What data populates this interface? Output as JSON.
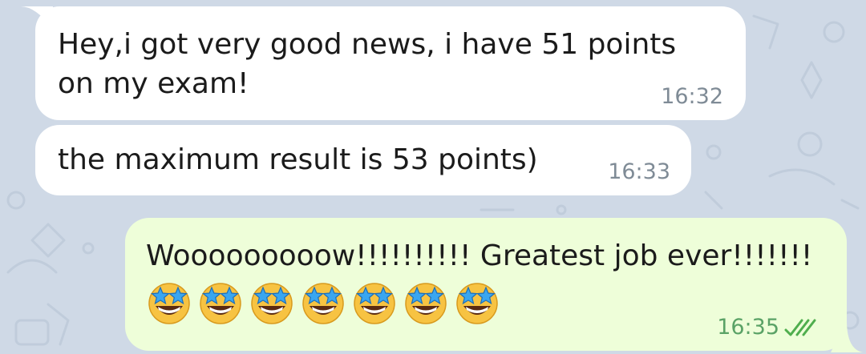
{
  "messages": [
    {
      "direction": "incoming",
      "lines": [
        "Hey,i got very good news, i have 51 points",
        "on my exam!"
      ],
      "time": "16:32"
    },
    {
      "direction": "incoming",
      "lines": [
        "the maximum result is 53 points)"
      ],
      "time": "16:33"
    },
    {
      "direction": "outgoing",
      "lines": [
        "Wooooooooow!!!!!!!!!! Greatest job ever!!!!!!!"
      ],
      "emoji_name": "star-struck-emoji",
      "emoji_count": 7,
      "time": "16:35",
      "status_icon": "double-check-icon",
      "status": "read"
    }
  ],
  "colors": {
    "wallpaper": "#cfd9e6",
    "incoming_bubble": "#ffffff",
    "outgoing_bubble": "#eefed9",
    "incoming_time": "#7f8b96",
    "outgoing_time": "#5aa266",
    "read_ticks": "#4fae4e"
  }
}
